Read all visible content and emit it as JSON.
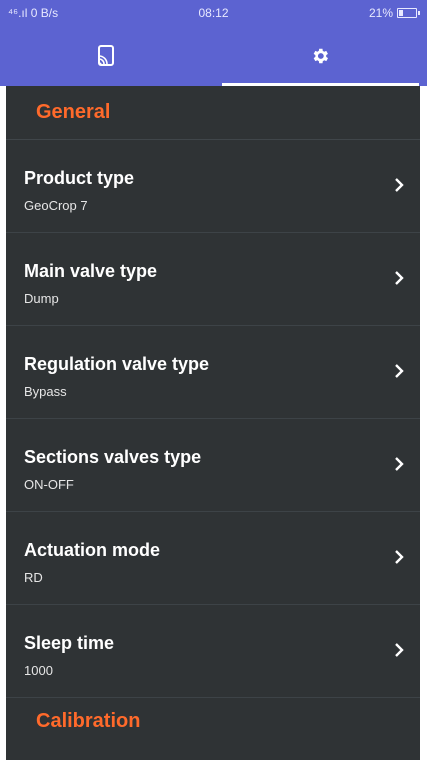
{
  "status_bar": {
    "left_text": "⁴⁶.ıl 0 B/s",
    "time": "08:12",
    "battery": "21%"
  },
  "tabs": [
    {
      "icon": "cast-device-icon",
      "active": false
    },
    {
      "icon": "gear-icon",
      "active": true
    }
  ],
  "settings": {
    "general_header": "General",
    "items": [
      {
        "title": "Product type",
        "value": "GeoCrop 7"
      },
      {
        "title": "Main valve type",
        "value": "Dump"
      },
      {
        "title": "Regulation valve type",
        "value": "Bypass"
      },
      {
        "title": "Sections valves type",
        "value": "ON-OFF"
      },
      {
        "title": "Actuation mode",
        "value": "RD"
      },
      {
        "title": "Sleep time",
        "value": "1000"
      }
    ],
    "calibration_header": "Calibration"
  },
  "colors": {
    "accent_bar": "#5c63d1",
    "section_header": "#ff6a2b",
    "panel_bg": "#2f3335"
  }
}
